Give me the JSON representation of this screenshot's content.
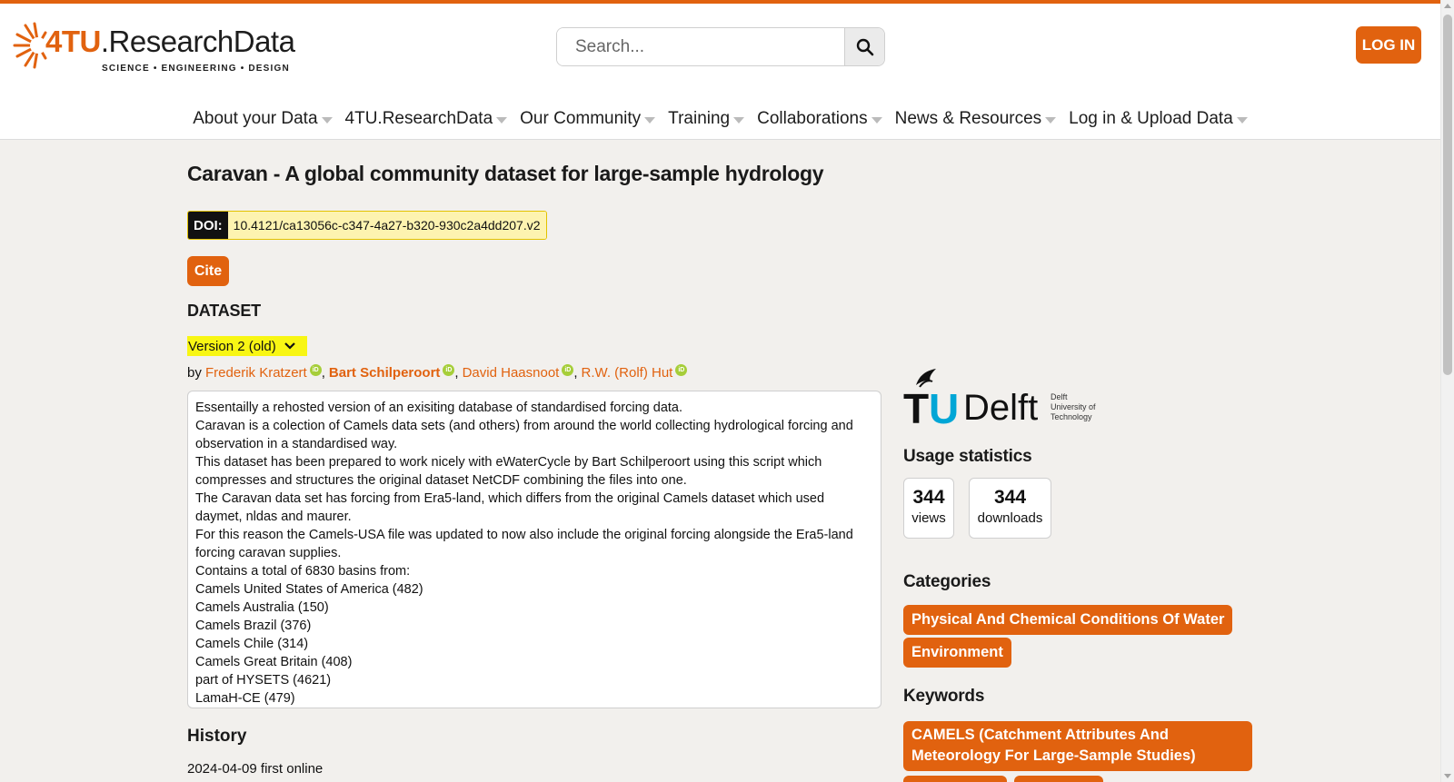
{
  "header": {
    "logo": {
      "brand_num": "4TU",
      "brand_rest": ".ResearchData",
      "tagline": "SCIENCE • ENGINEERING • DESIGN"
    },
    "search": {
      "placeholder": "Search..."
    },
    "login_label": "LOG IN",
    "nav": [
      {
        "label": "About your Data"
      },
      {
        "label": "4TU.ResearchData"
      },
      {
        "label": "Our Community"
      },
      {
        "label": "Training"
      },
      {
        "label": "Collaborations"
      },
      {
        "label": "News & Resources"
      },
      {
        "label": "Log in & Upload Data"
      }
    ]
  },
  "dataset": {
    "title": "Caravan - A global community dataset for large-sample hydrology",
    "doi_label": "DOI:",
    "doi": "10.4121/ca13056c-c347-4a27-b320-930c2a4dd207.v2",
    "cite_label": "Cite",
    "section_label": "DATASET",
    "version": "Version 2 (old)",
    "by_label": "by",
    "authors": [
      {
        "name": "Frederik Kratzert"
      },
      {
        "name": "Bart Schilperoort"
      },
      {
        "name": "David Haasnoot"
      },
      {
        "name": "R.W. (Rolf) Hut"
      }
    ],
    "description_lines": [
      "Essentailly a rehosted version of an exisiting database of standardised forcing data.",
      "Caravan is a colection of Camels data sets (and others) from around the world collecting hydrological forcing and observation in a standardised way.",
      "This dataset has been prepared to work nicely with eWaterCycle by Bart Schilperoort using this script which compresses and structures the original dataset NetCDF combining the files into one.",
      "The Caravan data set has forcing from Era5-land, which differs from the original Camels dataset which used daymet, nldas and maurer.",
      "For this reason the Camels-USA file was updated to now also include the original forcing alongside the Era5-land forcing caravan supplies.",
      "Contains a total of 6830 basins from:",
      "Camels United States of America (482)",
      "Camels Australia (150)",
      "Camels Brazil (376)",
      "Camels Chile (314)",
      "Camels Great Britain (408)",
      "part of HYSETS (4621)",
      "LamaH-CE (479)"
    ],
    "history_label": "History",
    "history_first": "2024-04-09 first online"
  },
  "sidebar": {
    "institution_logo": {
      "letters": "TU",
      "name": "Delft",
      "sub": [
        "Delft",
        "University of",
        "Technology"
      ]
    },
    "usage_label": "Usage statistics",
    "views_count": "344",
    "views_label": "views",
    "downloads_count": "344",
    "downloads_label": "downloads",
    "categories_label": "Categories",
    "categories": [
      "Physical And Chemical Conditions Of Water",
      "Environment"
    ],
    "keywords_label": "Keywords",
    "keywords": [
      "CAMELS (Catchment Attributes And Meteorology For Large-Sample Studies)"
    ]
  },
  "colors": {
    "accent": "#e1620f",
    "doi_bg": "#fdf3b0",
    "version_bg": "#f8f614",
    "orcid": "#a6ce39",
    "tud_blue": "#00a6d6"
  },
  "icons": {
    "search": "magnifier-icon",
    "version_chevron": "chevron-down-icon",
    "orcid": "orcid-icon",
    "nav_caret": "caret-down-icon"
  }
}
